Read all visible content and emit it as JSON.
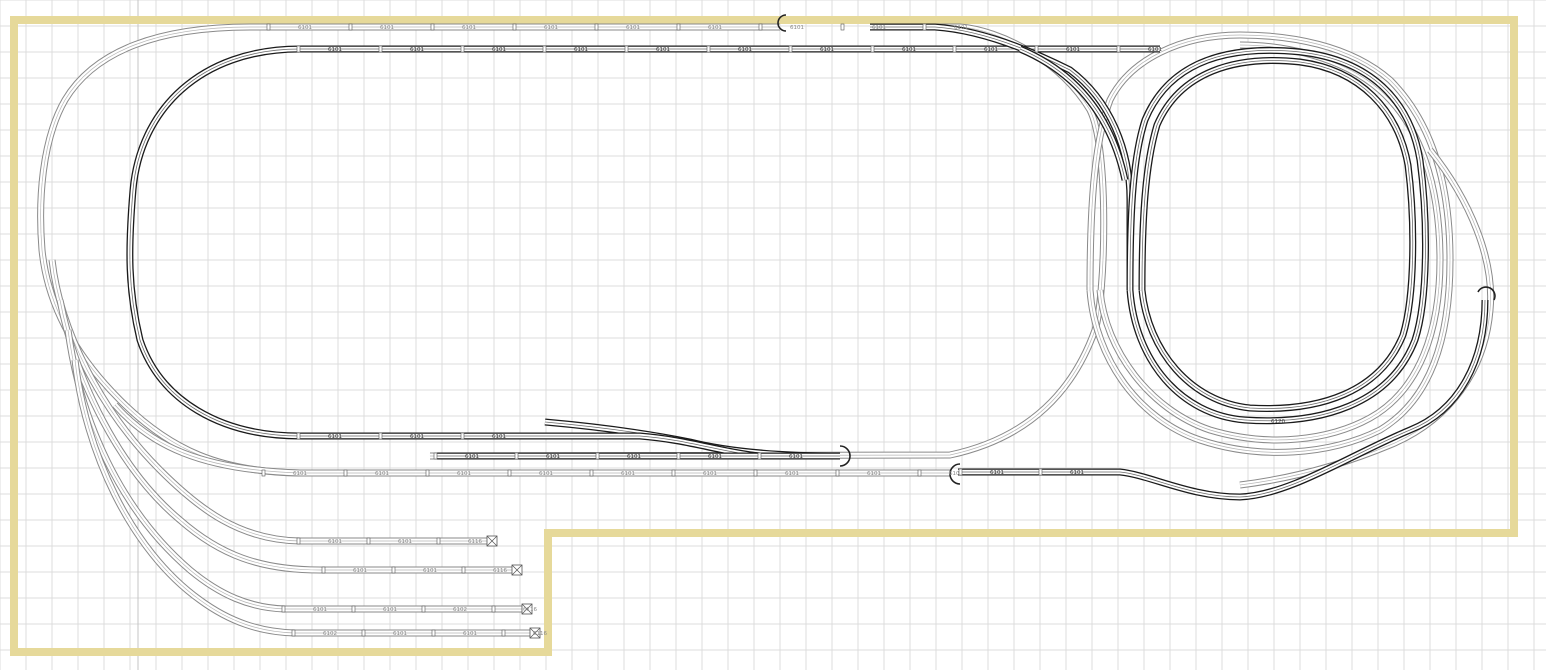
{
  "colors": {
    "background": "#ffffff",
    "grid": "#dcdcdc",
    "board": "#e6d99a",
    "track_upper": "#1a1a1a",
    "track_lower": "#8a8a8a"
  },
  "upper_labels": [
    "6101",
    "6101",
    "6101",
    "6101",
    "6101",
    "6101",
    "6101",
    "6101",
    "6101",
    "6101",
    "6101",
    "6101",
    "6101",
    "6101",
    "6101",
    "6101",
    "6101",
    "6101",
    "6101",
    "6101",
    "6101",
    "6101"
  ],
  "lower_labels": [
    "6101",
    "6101",
    "6101",
    "6101",
    "6101",
    "6101",
    "6101",
    "6101",
    "6101",
    "6101",
    "6101",
    "6101",
    "6101",
    "6101",
    "6101",
    "6101",
    "6101",
    "6101"
  ],
  "siding_labels": [
    [
      "6101",
      "6101",
      "6116"
    ],
    [
      "6101",
      "6101",
      "6116"
    ],
    [
      "6101",
      "6101",
      "6102",
      "6116"
    ],
    [
      "6102",
      "6101",
      "6101",
      "6116"
    ]
  ],
  "bottom_right_labels": [
    "6101",
    "6101"
  ],
  "inner_loop_label": "6120"
}
